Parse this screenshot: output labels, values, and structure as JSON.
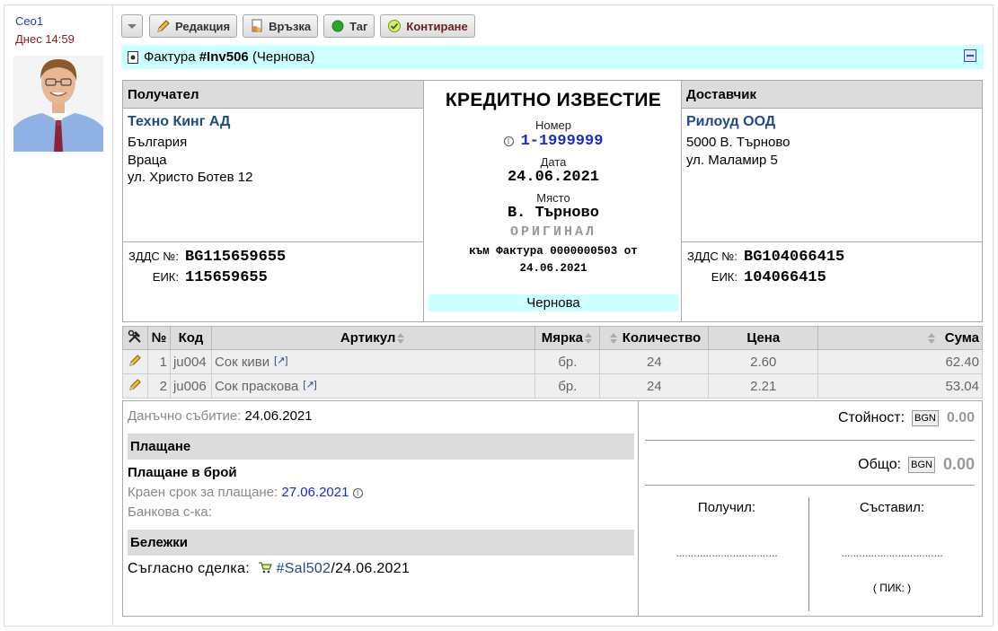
{
  "user": {
    "name": "Ceo1",
    "time": "Днес 14:59",
    "avatar_icon": "user-avatar-icon"
  },
  "toolbar": {
    "dropdown_icon": "chevron-down-icon",
    "edit_label": "Редакция",
    "link_label": "Връзка",
    "tag_label": "Таг",
    "post_label": "Контиране"
  },
  "document": {
    "type_label": "Фактура",
    "number": "#Inv506",
    "status_suffix": "(Чернова)"
  },
  "recipient": {
    "header": "Получател",
    "company": "Техно Кинг АД",
    "address": [
      "България",
      "Враца",
      "ул. Христо Ботев 12"
    ],
    "vat_label": "ЗДДС №:",
    "vat": "BG115659655",
    "eik_label": "ЕИК:",
    "eik": "115659655"
  },
  "middle": {
    "title": "КРЕДИТНО ИЗВЕСТИЕ",
    "number_label": "Номер",
    "number": "1-1999999",
    "date_label": "Дата",
    "date": "24.06.2021",
    "place_label": "Място",
    "place": "В. Търново",
    "original": "ОРИГИНАЛ",
    "ref_line1": "към Фактура 0000000503 от",
    "ref_line2": "24.06.2021",
    "state": "Чернова"
  },
  "supplier": {
    "header": "Доставчик",
    "company": "Рилоуд ООД",
    "address": [
      "5000 В. Търново",
      "ул. Маламир 5"
    ],
    "vat_label": "ЗДДС №:",
    "vat": "BG104066415",
    "eik_label": "ЕИК:",
    "eik": "104066415"
  },
  "table": {
    "columns": {
      "num": "№",
      "code": "Код",
      "article": "Артикул",
      "measure": "Мярка",
      "qty": "Количество",
      "price": "Цена",
      "sum": "Сума"
    },
    "rows": [
      {
        "num": "1",
        "code": "ju004",
        "article": "Сок киви",
        "measure": "бр.",
        "qty": "24",
        "price": "2.60",
        "sum": "62.40"
      },
      {
        "num": "2",
        "code": "ju006",
        "article": "Сок праскова",
        "measure": "бр.",
        "qty": "24",
        "price": "2.21",
        "sum": "53.04"
      }
    ]
  },
  "footer": {
    "tax_event_label": "Данъчно събитие:",
    "tax_event": "24.06.2021",
    "payment_header": "Плащане",
    "payment_method": "Плащане в брой",
    "due_label": "Краен срок за плащане:",
    "due_date": "27.06.2021",
    "bank_label": "Банкова с-ка:",
    "notes_header": "Бележки",
    "notes_text": "Съгласно сделка:",
    "deal_link": "#Sal502",
    "deal_date": "/24.06.2021",
    "value_label": "Стойност:",
    "total_label": "Общо:",
    "currency": "BGN",
    "value": "0.00",
    "total": "0.00",
    "received_label": "Получил:",
    "compiled_label": "Съставил:",
    "dots": "..................................",
    "pik": "( ПИК: )"
  }
}
